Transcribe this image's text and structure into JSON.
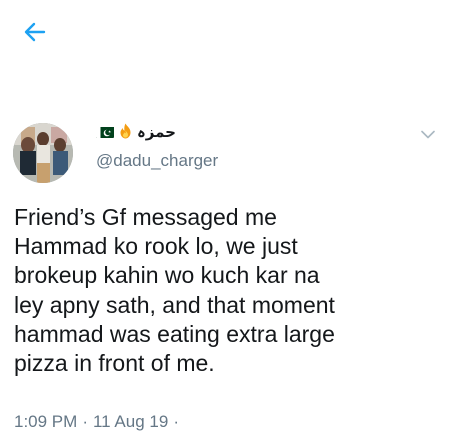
{
  "header": {
    "back_icon": "back-arrow-icon"
  },
  "tweet": {
    "display_name": "حمزہ",
    "name_emojis": [
      "fire-icon",
      "pakistan-flag-icon"
    ],
    "handle": "@dadu_charger",
    "text": "Friend’s Gf messaged me\nHammad ko rook lo, we just\nbrokeup kahin wo kuch kar na\nley apny sath, and that moment\nhammad was eating extra large\npizza in front of me.",
    "time": "1:09 PM",
    "separator": "·",
    "date": "11 Aug 19",
    "trailing_dot": "·"
  },
  "colors": {
    "accent": "#1da1f2",
    "text_primary": "#14171a",
    "text_secondary": "#657786",
    "flag_green": "#01411c"
  }
}
